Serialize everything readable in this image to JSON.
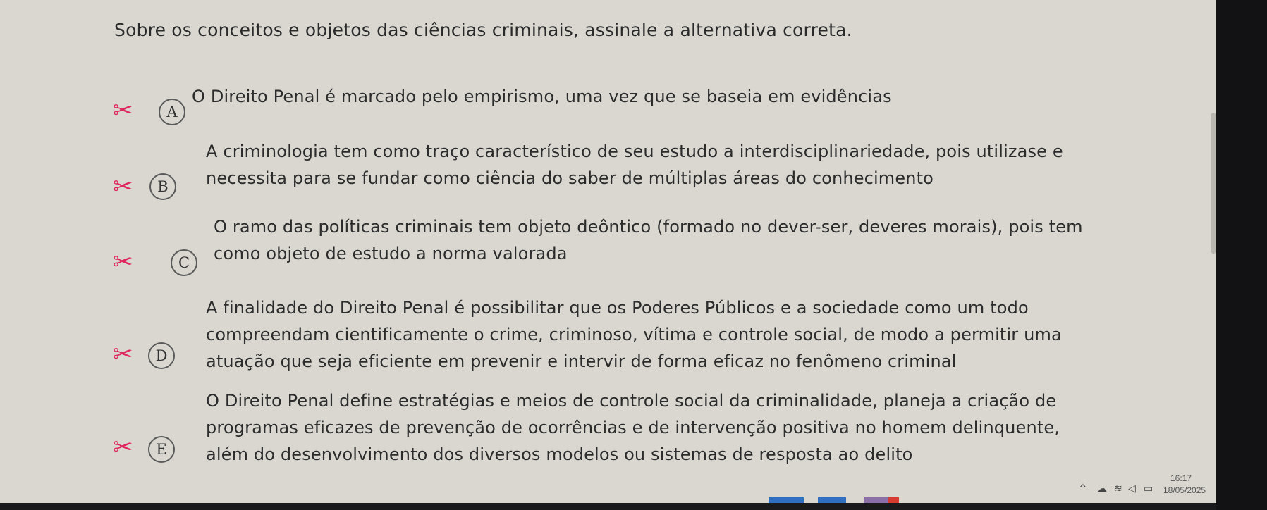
{
  "question": "Sobre os conceitos e objetos das ciências criminais, assinale a alternativa correta.",
  "options": [
    {
      "letter": "A",
      "lines": [
        "O Direito Penal é marcado pelo empirismo, uma vez que se baseia em evidências"
      ]
    },
    {
      "letter": "B",
      "lines": [
        "A criminologia tem como traço característico de seu estudo a interdisciplinariedade, pois utilizase e",
        "necessita para se fundar como ciência do saber de múltiplas áreas do conhecimento"
      ]
    },
    {
      "letter": "C",
      "lines": [
        "O ramo das políticas criminais tem objeto deôntico (formado no dever-ser, deveres morais), pois tem",
        "como objeto de estudo a norma valorada"
      ]
    },
    {
      "letter": "D",
      "lines": [
        "A finalidade do Direito Penal é possibilitar que os Poderes Públicos e a sociedade como um todo",
        "compreendam cientificamente o crime, criminoso, vítima e controle social, de modo a permitir uma",
        "atuação que seja eficiente em prevenir e intervir de forma eficaz no fenômeno criminal"
      ]
    },
    {
      "letter": "E",
      "lines": [
        "O Direito Penal define estratégias e meios de controle social da criminalidade, planeja a criação de",
        "programas eficazes de prevenção de ocorrências e de intervenção positiva no homem delinquente,",
        "além do desenvolvimento dos diversos modelos ou sistemas de resposta ao delito"
      ]
    }
  ],
  "icons": {
    "cut": "scissors-icon"
  },
  "colors": {
    "scissors": "#e0245e"
  },
  "tray": {
    "time": "16:17",
    "date": "18/05/2025"
  }
}
